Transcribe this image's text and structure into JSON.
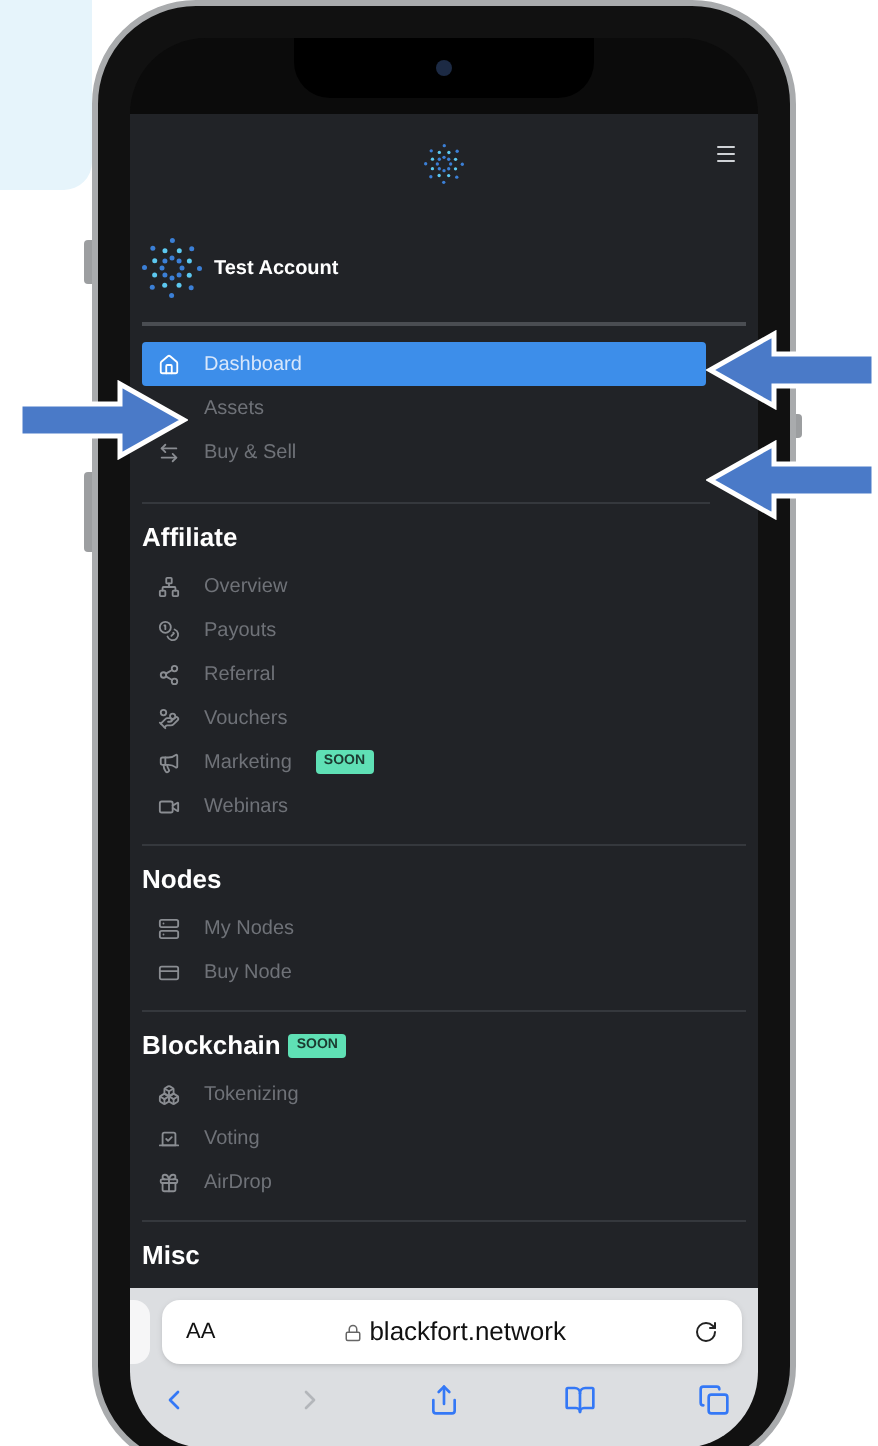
{
  "account": {
    "name": "Test Account"
  },
  "nav_items": [
    {
      "label": "Dashboard",
      "selected": true
    },
    {
      "label": "Assets",
      "selected": false
    },
    {
      "label": "Buy & Sell",
      "selected": false
    }
  ],
  "sections": [
    {
      "title": "Affiliate",
      "items": [
        {
          "label": "Overview"
        },
        {
          "label": "Payouts"
        },
        {
          "label": "Referral"
        },
        {
          "label": "Vouchers"
        },
        {
          "label": "Marketing",
          "badge": "SOON"
        },
        {
          "label": "Webinars"
        }
      ]
    },
    {
      "title": "Nodes",
      "items": [
        {
          "label": "My Nodes"
        },
        {
          "label": "Buy Node"
        }
      ]
    },
    {
      "title": "Blockchain",
      "badge": "SOON",
      "items": [
        {
          "label": "Tokenizing"
        },
        {
          "label": "Voting"
        },
        {
          "label": "AirDrop"
        }
      ]
    },
    {
      "title": "Misc"
    }
  ],
  "browser": {
    "text_size": "AA",
    "url": "blackfort.network"
  }
}
